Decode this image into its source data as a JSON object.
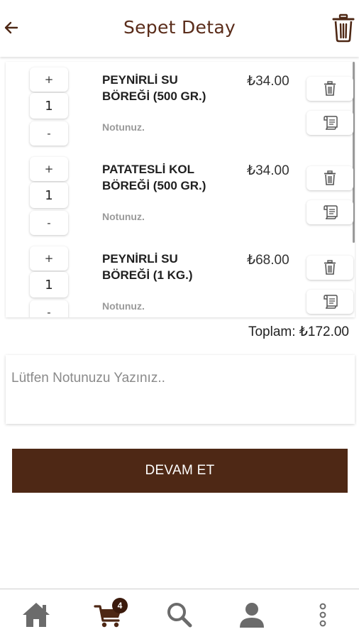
{
  "header": {
    "title": "Sepet Detay",
    "back_icon": "arrow-left-icon",
    "delete_all_icon": "trash-icon"
  },
  "cart": {
    "items": [
      {
        "name_line1": "PEYNİRLİ SU",
        "name_line2": "BÖREĞİ (500 GR.)",
        "price": "₺34.00",
        "quantity": "1",
        "note": "Notunuz.",
        "plus_label": "+",
        "minus_label": "-"
      },
      {
        "name_line1": "PATATESLİ KOL",
        "name_line2": "BÖREĞİ (500 GR.)",
        "price": "₺34.00",
        "quantity": "1",
        "note": "Notunuz.",
        "plus_label": "+",
        "minus_label": "-"
      },
      {
        "name_line1": "PEYNİRLİ SU",
        "name_line2": "BÖREĞİ (1 KG.)",
        "price": "₺68.00",
        "quantity": "1",
        "note": "Notunuz.",
        "plus_label": "+",
        "minus_label": "-"
      }
    ]
  },
  "total": "Toplam: ₺172.00",
  "note_input": {
    "placeholder": "Lütfen Notunuzu Yazınız..",
    "value": ""
  },
  "continue_button": "DEVAM ET",
  "bottom_nav": {
    "items": [
      "home-icon",
      "cart-icon",
      "search-icon",
      "user-icon",
      "more-vertical-icon"
    ],
    "cart_badge": "4"
  },
  "colors": {
    "brand": "#4e2815",
    "title": "#5a2c1a",
    "nav_icon": "#6b6b6b"
  }
}
